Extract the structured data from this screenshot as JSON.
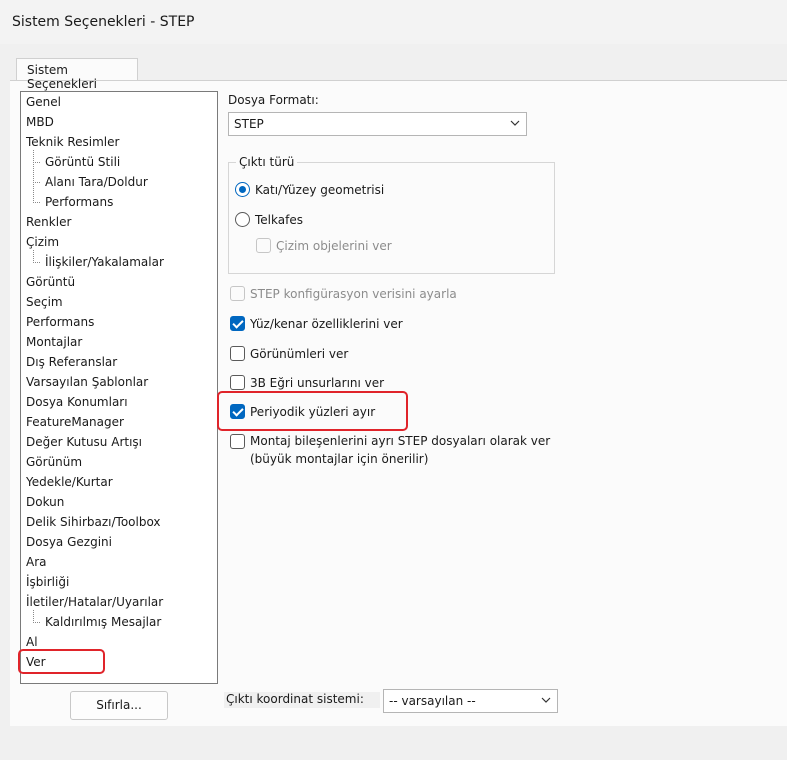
{
  "window": {
    "title": "Sistem Seçenekleri - STEP"
  },
  "tabs": [
    {
      "label": "Sistem Seçenekleri"
    }
  ],
  "tree": {
    "items": [
      {
        "label": "Genel",
        "level": 0
      },
      {
        "label": "MBD",
        "level": 0
      },
      {
        "label": "Teknik Resimler",
        "level": 0
      },
      {
        "label": "Görüntü Stili",
        "level": 1
      },
      {
        "label": "Alanı Tara/Doldur",
        "level": 1
      },
      {
        "label": "Performans",
        "level": 1
      },
      {
        "label": "Renkler",
        "level": 0
      },
      {
        "label": "Çizim",
        "level": 0
      },
      {
        "label": "İlişkiler/Yakalamalar",
        "level": 1
      },
      {
        "label": "Görüntü",
        "level": 0
      },
      {
        "label": "Seçim",
        "level": 0
      },
      {
        "label": "Performans",
        "level": 0
      },
      {
        "label": "Montajlar",
        "level": 0
      },
      {
        "label": "Dış Referanslar",
        "level": 0
      },
      {
        "label": "Varsayılan Şablonlar",
        "level": 0
      },
      {
        "label": "Dosya Konumları",
        "level": 0
      },
      {
        "label": "FeatureManager",
        "level": 0
      },
      {
        "label": "Değer Kutusu Artışı",
        "level": 0
      },
      {
        "label": "Görünüm",
        "level": 0
      },
      {
        "label": "Yedekle/Kurtar",
        "level": 0
      },
      {
        "label": "Dokun",
        "level": 0
      },
      {
        "label": "Delik Sihirbazı/Toolbox",
        "level": 0
      },
      {
        "label": "Dosya Gezgini",
        "level": 0
      },
      {
        "label": "Ara",
        "level": 0
      },
      {
        "label": "İşbirliği",
        "level": 0
      },
      {
        "label": "İletiler/Hatalar/Uyarılar",
        "level": 0
      },
      {
        "label": "Kaldırılmış Mesajlar",
        "level": 1
      },
      {
        "label": "Al",
        "level": 0
      },
      {
        "label": "Ver",
        "level": 0,
        "selected": true
      }
    ]
  },
  "buttons": {
    "reset": "Sıfırla..."
  },
  "format": {
    "label": "Dosya Formatı:",
    "value": "STEP"
  },
  "output_type": {
    "title": "Çıktı türü",
    "solid_surface": {
      "label": "Katı/Yüzey geometrisi",
      "checked": true
    },
    "wireframe": {
      "label": "Telkafes",
      "checked": false
    },
    "sketch_entities": {
      "label": "Çizim objelerini ver",
      "checked": false,
      "disabled": true
    }
  },
  "options": {
    "step_config": {
      "label": "STEP konfigürasyon verisini ayarla",
      "checked": false,
      "disabled": true
    },
    "face_edge": {
      "label": "Yüz/kenar özelliklerini ver",
      "checked": true
    },
    "views": {
      "label": "Görünümleri ver",
      "checked": false
    },
    "curve3d": {
      "label": "3B Eğri unsurlarını ver",
      "checked": false
    },
    "split_periodic": {
      "label": "Periyodik yüzleri ayır",
      "checked": true
    },
    "assembly_components": {
      "label": "Montaj bileşenlerini ayrı STEP dosyaları olarak ver",
      "sublabel": "(büyük montajlar için önerilir)",
      "checked": false
    }
  },
  "coord_system": {
    "label": "Çıktı koordinat sistemi:",
    "value": "-- varsayılan --"
  },
  "colors": {
    "accent": "#0067c0",
    "highlight": "#e0242a"
  }
}
